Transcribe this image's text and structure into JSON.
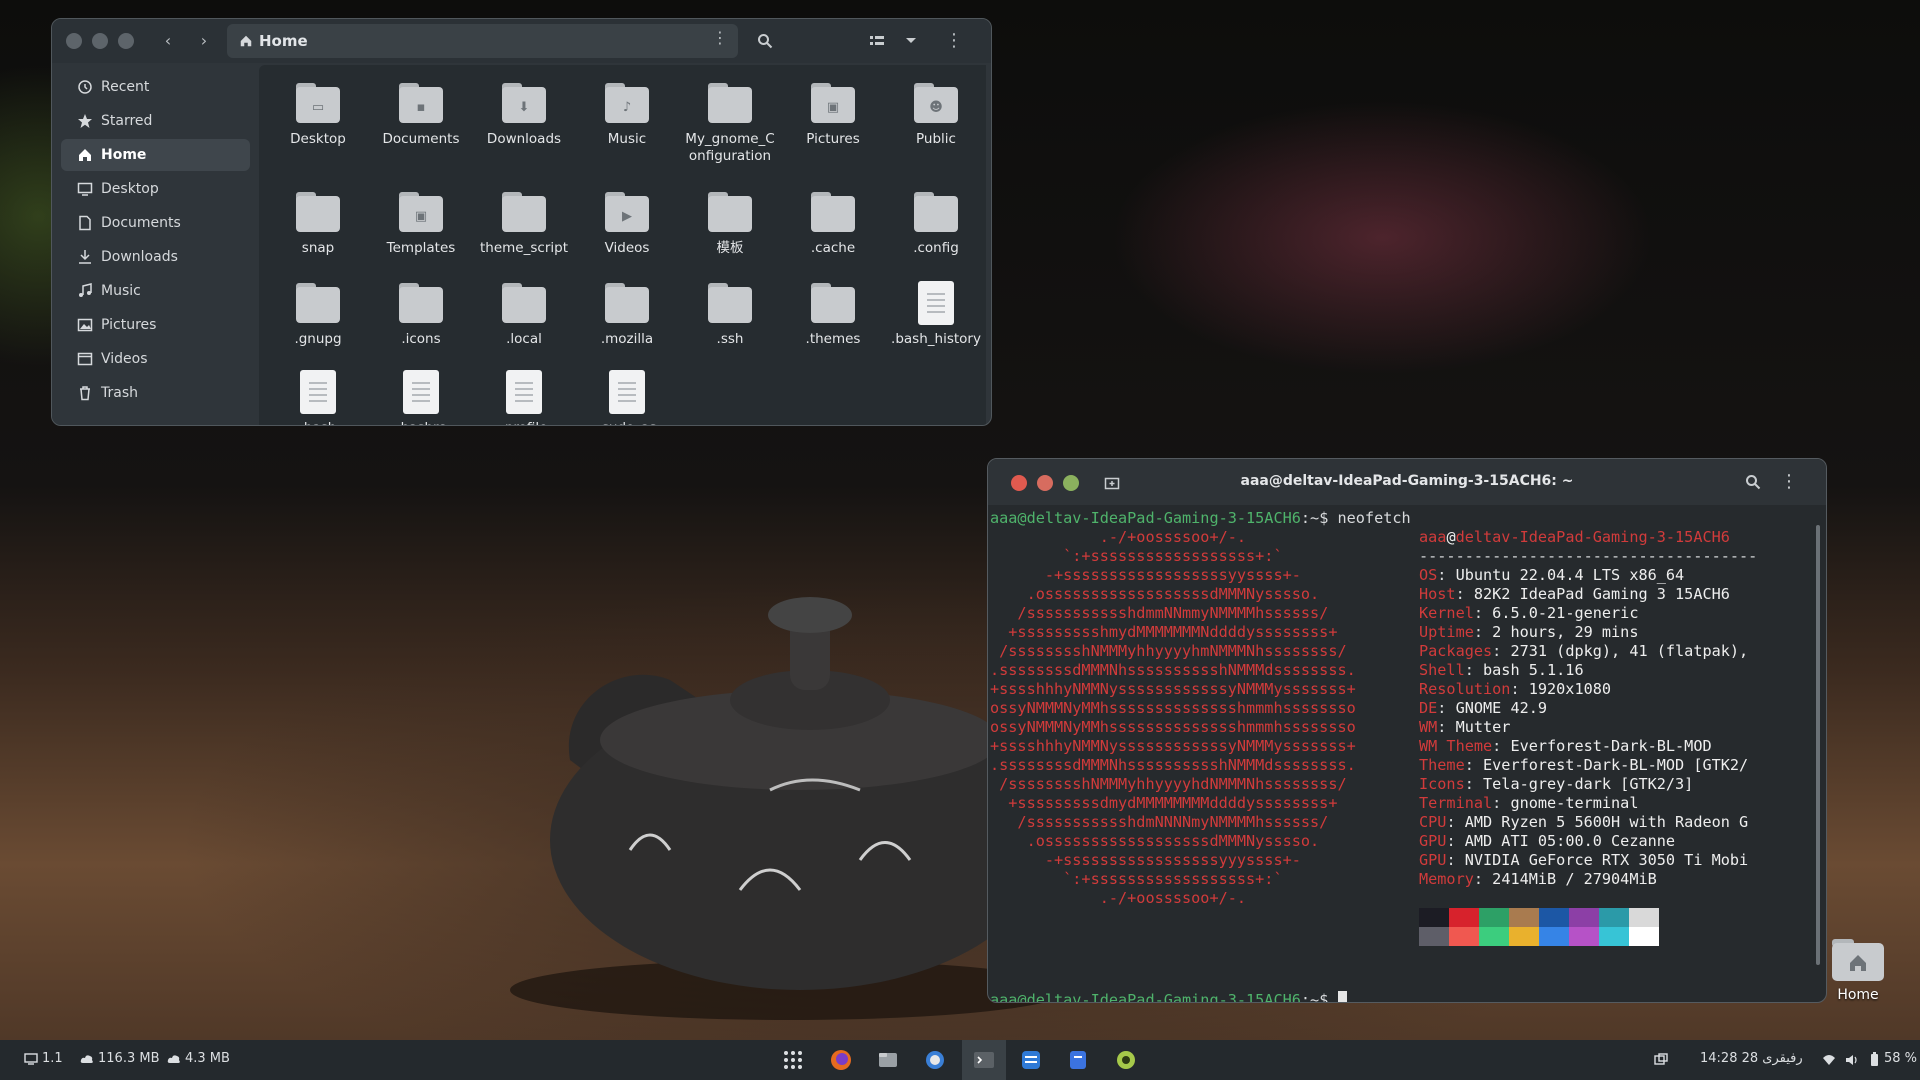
{
  "files": {
    "path_label": "Home",
    "sidebar": [
      {
        "label": "Recent",
        "icon": "clock-icon"
      },
      {
        "label": "Starred",
        "icon": "star-icon"
      },
      {
        "label": "Home",
        "icon": "home-icon",
        "active": true
      },
      {
        "label": "Desktop",
        "icon": "desktop-icon"
      },
      {
        "label": "Documents",
        "icon": "document-icon"
      },
      {
        "label": "Downloads",
        "icon": "download-icon"
      },
      {
        "label": "Music",
        "icon": "music-icon"
      },
      {
        "label": "Pictures",
        "icon": "picture-icon"
      },
      {
        "label": "Videos",
        "icon": "video-icon"
      },
      {
        "label": "Trash",
        "icon": "trash-icon"
      }
    ],
    "items": [
      {
        "label": "Desktop",
        "kind": "folder",
        "emblem": "desktop"
      },
      {
        "label": "Documents",
        "kind": "folder",
        "emblem": "document"
      },
      {
        "label": "Downloads",
        "kind": "folder",
        "emblem": "download"
      },
      {
        "label": "Music",
        "kind": "folder",
        "emblem": "music"
      },
      {
        "label": "My_gnome_Configuration",
        "kind": "folder",
        "emblem": ""
      },
      {
        "label": "Pictures",
        "kind": "folder",
        "emblem": "picture"
      },
      {
        "label": "Public",
        "kind": "folder",
        "emblem": "public"
      },
      {
        "label": "snap",
        "kind": "folder",
        "emblem": ""
      },
      {
        "label": "Templates",
        "kind": "folder",
        "emblem": "template"
      },
      {
        "label": "theme_script",
        "kind": "folder",
        "emblem": ""
      },
      {
        "label": "Videos",
        "kind": "folder",
        "emblem": "video"
      },
      {
        "label": "模板",
        "kind": "folder",
        "emblem": ""
      },
      {
        "label": ".cache",
        "kind": "folder",
        "emblem": ""
      },
      {
        "label": ".config",
        "kind": "folder",
        "emblem": ""
      },
      {
        "label": ".gnupg",
        "kind": "folder",
        "emblem": ""
      },
      {
        "label": ".icons",
        "kind": "folder",
        "emblem": ""
      },
      {
        "label": ".local",
        "kind": "folder",
        "emblem": ""
      },
      {
        "label": ".mozilla",
        "kind": "folder",
        "emblem": ""
      },
      {
        "label": ".ssh",
        "kind": "folder",
        "emblem": ""
      },
      {
        "label": ".themes",
        "kind": "folder",
        "emblem": ""
      },
      {
        "label": ".bash_history",
        "kind": "file",
        "emblem": ""
      },
      {
        "label": ".bash",
        "kind": "file",
        "emblem": ""
      },
      {
        "label": ".bashrc",
        "kind": "file",
        "emblem": ""
      },
      {
        "label": ".profile",
        "kind": "file",
        "emblem": ""
      },
      {
        "label": ".sudo_as",
        "kind": "file",
        "emblem": ""
      }
    ]
  },
  "terminal": {
    "title": "aaa@deltav-IdeaPad-Gaming-3-15ACH6: ~",
    "prompt_user": "aaa@deltav-IdeaPad-Gaming-3-15ACH6",
    "prompt_path": ":~",
    "prompt_symbol": "$",
    "command": "neofetch",
    "logo_lines": [
      "            .-/+oossssoo+/-.",
      "        `:+ssssssssssssssssss+:`",
      "      -+ssssssssssssssssssyyssss+-",
      "    .ossssssssssssssssssdMMMNysssso.",
      "   /ssssssssssshdmmNNmmyNMMMMhssssss/",
      "  +ssssssssshmydMMMMMMMNddddyssssssss+",
      " /sssssssshNMMMyhhyyyyhmNMMMNhssssssss/",
      ".ssssssssdMMMNhsssssssssshNMMMdssssssss.",
      "+sssshhhyNMMNyssssssssssssyNMMMysssssss+",
      "ossyNMMMNyMMhsssssssssssssshmmmhssssssso",
      "ossyNMMMNyMMhsssssssssssssshmmmhssssssso",
      "+sssshhhyNMMNyssssssssssssyNMMMysssssss+",
      ".ssssssssdMMMNhsssssssssshNMMMdssssssss.",
      " /sssssssshNMMMyhhyyyyhdNMMMNhssssssss/",
      "  +sssssssssdmydMMMMMMMMddddyssssssss+",
      "   /ssssssssssshdmNNNNmyNMMMMhssssss/",
      "    .ossssssssssssssssssdMMMNysssso.",
      "      -+sssssssssssssssssyyyssss+-",
      "        `:+ssssssssssssssssss+:`",
      "            .-/+oossssoo+/-."
    ],
    "info_header_user": "aaa",
    "info_header_host": "deltav-IdeaPad-Gaming-3-15ACH6",
    "info_separator": "-------------------------------------",
    "info": [
      {
        "key": "OS",
        "value": "Ubuntu 22.04.4 LTS x86_64"
      },
      {
        "key": "Host",
        "value": "82K2 IdeaPad Gaming 3 15ACH6"
      },
      {
        "key": "Kernel",
        "value": "6.5.0-21-generic"
      },
      {
        "key": "Uptime",
        "value": "2 hours, 29 mins"
      },
      {
        "key": "Packages",
        "value": "2731 (dpkg), 41 (flatpak),"
      },
      {
        "key": "Shell",
        "value": "bash 5.1.16"
      },
      {
        "key": "Resolution",
        "value": "1920x1080"
      },
      {
        "key": "DE",
        "value": "GNOME 42.9"
      },
      {
        "key": "WM",
        "value": "Mutter"
      },
      {
        "key": "WM Theme",
        "value": "Everforest-Dark-BL-MOD"
      },
      {
        "key": "Theme",
        "value": "Everforest-Dark-BL-MOD [GTK2/"
      },
      {
        "key": "Icons",
        "value": "Tela-grey-dark [GTK2/3]"
      },
      {
        "key": "Terminal",
        "value": "gnome-terminal"
      },
      {
        "key": "CPU",
        "value": "AMD Ryzen 5 5600H with Radeon G"
      },
      {
        "key": "GPU",
        "value": "AMD ATI 05:00.0 Cezanne"
      },
      {
        "key": "GPU",
        "value": "NVIDIA GeForce RTX 3050 Ti Mobi"
      },
      {
        "key": "Memory",
        "value": "2414MiB / 27904MiB"
      }
    ],
    "palette_top": [
      "#1c1c24",
      "#d7222c",
      "#2da066",
      "#a97b4f",
      "#1c57a5",
      "#8c3fa6",
      "#2b9aa8",
      "#d9d9d9"
    ],
    "palette_bottom": [
      "#5e5e68",
      "#f05850",
      "#3ccd7e",
      "#e9b12d",
      "#3684e6",
      "#b652c7",
      "#37c4d6",
      "#ffffff"
    ]
  },
  "desktop_icon": {
    "label": "Home"
  },
  "taskbar": {
    "workspace": "1.1",
    "upload": "116.3 MB",
    "download": "4.3 MB",
    "clock": "14:28  28 رفیقری",
    "battery": "58 %"
  },
  "colors": {
    "accent_green": "#4fb36b",
    "accent_red": "#d13b3b",
    "window_bg": "#2f353a"
  }
}
